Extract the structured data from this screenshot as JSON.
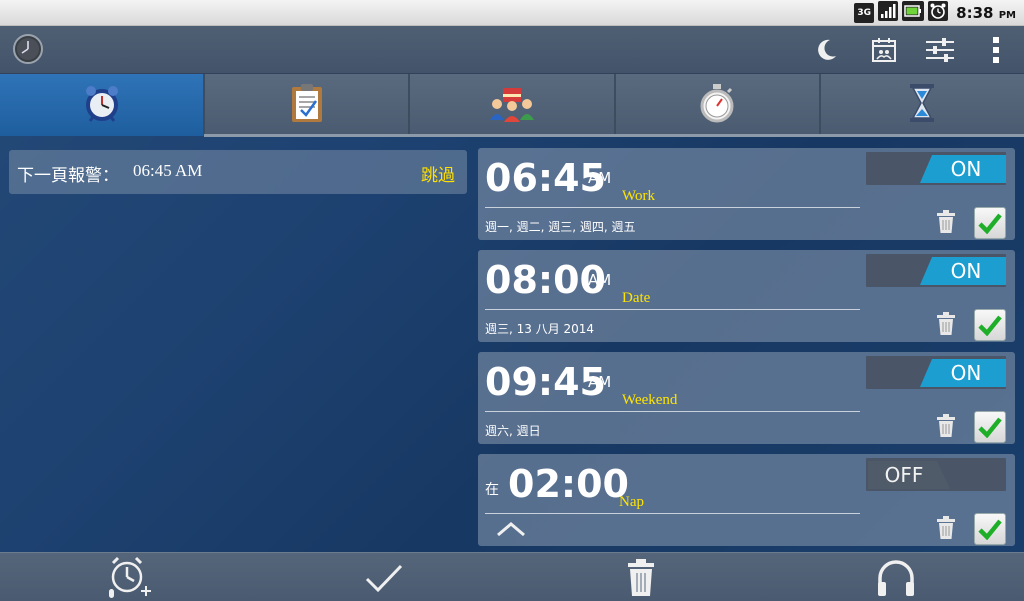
{
  "status_bar": {
    "network": "3G",
    "time": "8:38",
    "time_suffix": "PM"
  },
  "action_bar": {
    "icons": [
      "clock-icon",
      "moon-icon",
      "calendar-icon",
      "sliders-icon",
      "overflow-menu-icon"
    ]
  },
  "tabs": [
    {
      "name": "alarm-clock-icon",
      "active": true
    },
    {
      "name": "clipboard-icon",
      "active": false
    },
    {
      "name": "birthday-icon",
      "active": false
    },
    {
      "name": "stopwatch-icon",
      "active": false
    },
    {
      "name": "hourglass-icon",
      "active": false
    }
  ],
  "next_alarm": {
    "label": "下一頁報警：",
    "time": "06:45 AM",
    "skip": "跳過"
  },
  "alarms": [
    {
      "prefix": "",
      "time": "06:45",
      "ampm": "AM",
      "name": "Work",
      "days": "週一, 週二, 週三, 週四, 週五",
      "state": "ON",
      "checked": true
    },
    {
      "prefix": "",
      "time": "08:00",
      "ampm": "AM",
      "name": "Date",
      "days": "週三, 13 八月 2014",
      "state": "ON",
      "checked": true
    },
    {
      "prefix": "",
      "time": "09:45",
      "ampm": "AM",
      "name": "Weekend",
      "days": "週六, 週日",
      "state": "ON",
      "checked": true
    },
    {
      "prefix": "在",
      "time": "02:00",
      "ampm": "",
      "name": "Nap",
      "days": "",
      "state": "OFF",
      "checked": true
    }
  ],
  "bottom_bar": {
    "icons": [
      "add-voice-alarm-icon",
      "checkmark-icon",
      "trash-icon",
      "headphones-icon"
    ]
  },
  "colors": {
    "accent_on": "#1c9fd0",
    "name_yellow": "#ffe400",
    "active_tab": "#2f74b8"
  }
}
